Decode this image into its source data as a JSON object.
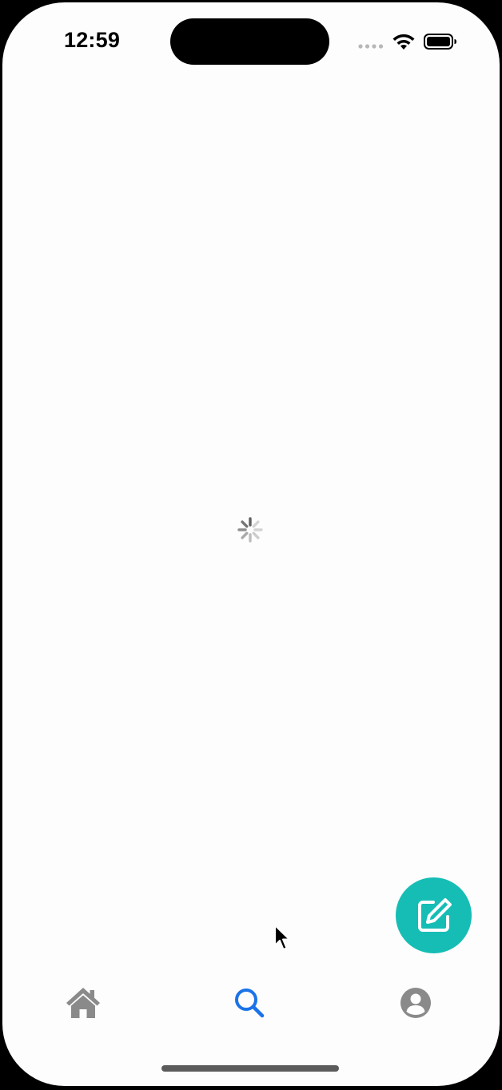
{
  "status_bar": {
    "time": "12:59",
    "signal_icon": "cellular-signal-dots-icon",
    "wifi_icon": "wifi-icon",
    "battery_icon": "battery-full-icon"
  },
  "main": {
    "state": "loading",
    "spinner_icon": "activity-spinner-icon",
    "spinner_color": "#8e8e8e"
  },
  "fab": {
    "icon": "compose-edit-icon",
    "color": "#16bdb5"
  },
  "tab_bar": {
    "active_tab": "search",
    "active_color": "#1a73e8",
    "inactive_color": "#8a8a8a",
    "tabs": [
      {
        "id": "home",
        "icon": "house-icon",
        "active": false
      },
      {
        "id": "search",
        "icon": "magnifying-glass-icon",
        "active": true
      },
      {
        "id": "profile",
        "icon": "person-circle-icon",
        "active": false
      }
    ]
  }
}
